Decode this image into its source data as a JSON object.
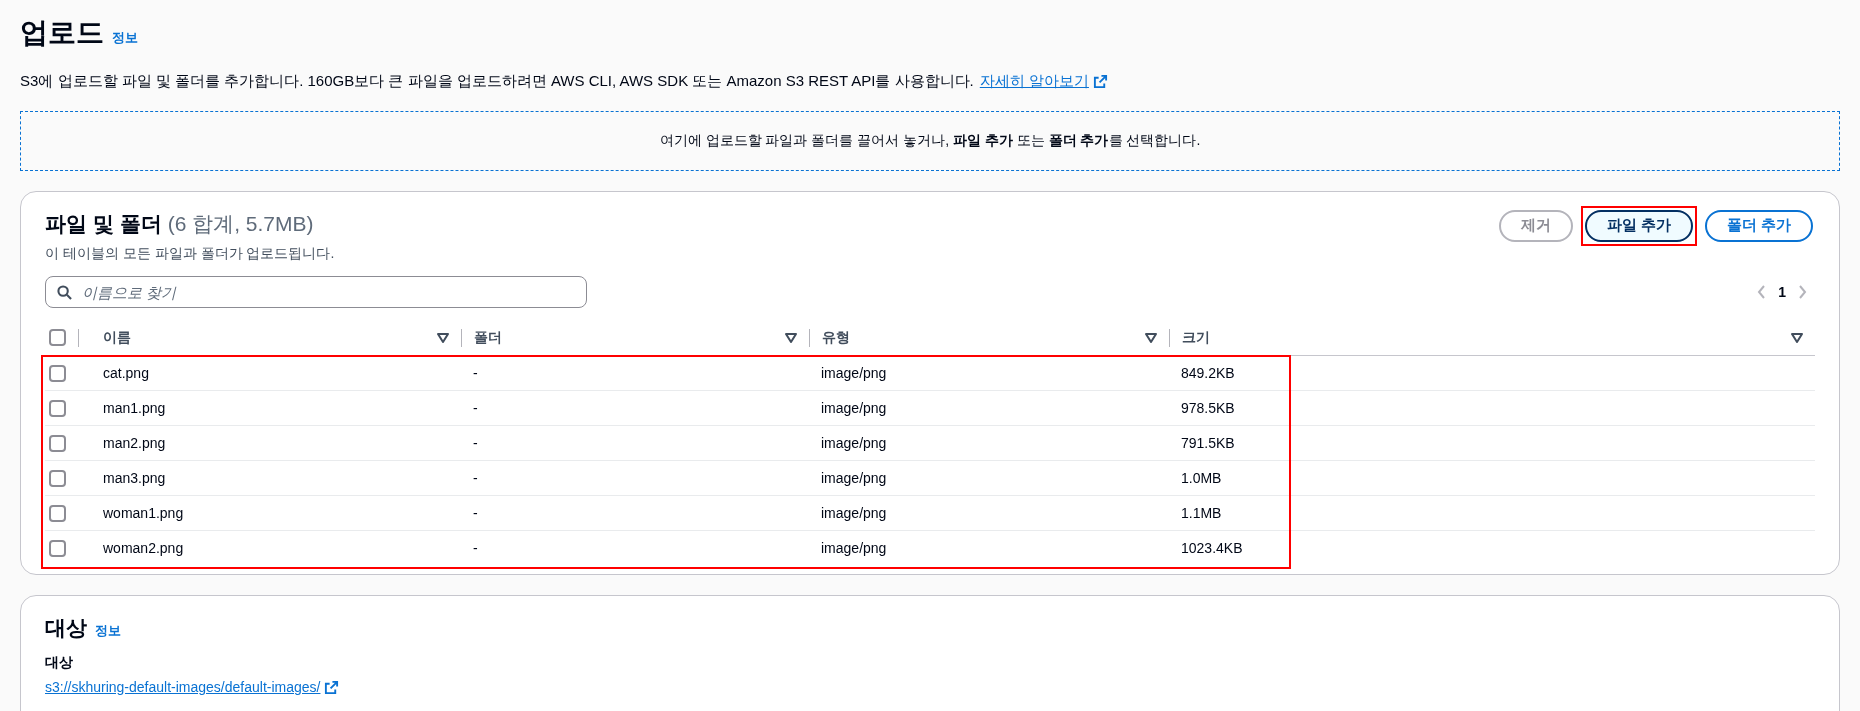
{
  "page": {
    "title": "업로드",
    "info_link": "정보",
    "description": "S3에 업로드할 파일 및 폴더를 추가합니다. 160GB보다 큰 파일을 업로드하려면 AWS CLI, AWS SDK 또는 Amazon S3 REST API를 사용합니다.",
    "learn_more": "자세히 알아보기"
  },
  "dropzone": {
    "text": "여기에 업로드할 파일과 폴더를 끌어서 놓거나, **파일 추가** 또는 **폴더 추가**를 선택합니다."
  },
  "files_panel": {
    "title": "파일 및 폴더",
    "summary": "(6 합계, 5.7MB)",
    "subtitle": "이 테이블의 모든 파일과 폴더가 업로드됩니다.",
    "buttons": [
      {
        "label": "제거",
        "kind": "disabled",
        "highlighted": false
      },
      {
        "label": "파일 추가",
        "kind": "focused",
        "highlighted": true
      },
      {
        "label": "폴더 추가",
        "kind": "normal",
        "highlighted": false
      }
    ],
    "search": {
      "placeholder": "이름으로 찾기"
    },
    "pagination": {
      "page": "1"
    },
    "columns": [
      "이름",
      "폴더",
      "유형",
      "크기"
    ],
    "rows_highlighted": true,
    "select_all_checked": false,
    "rows": [
      {
        "name": "cat.png",
        "folder": "-",
        "type": "image/png",
        "size": "849.2KB",
        "checked": false
      },
      {
        "name": "man1.png",
        "folder": "-",
        "type": "image/png",
        "size": "978.5KB",
        "checked": false
      },
      {
        "name": "man2.png",
        "folder": "-",
        "type": "image/png",
        "size": "791.5KB",
        "checked": false
      },
      {
        "name": "man3.png",
        "folder": "-",
        "type": "image/png",
        "size": "1.0MB",
        "checked": false
      },
      {
        "name": "woman1.png",
        "folder": "-",
        "type": "image/png",
        "size": "1.1MB",
        "checked": false
      },
      {
        "name": "woman2.png",
        "folder": "-",
        "type": "image/png",
        "size": "1023.4KB",
        "checked": false
      }
    ]
  },
  "destination_panel": {
    "title": "대상",
    "info_link": "정보",
    "label": "대상",
    "link": "s3://skhuring-default-images/default-images/"
  }
}
